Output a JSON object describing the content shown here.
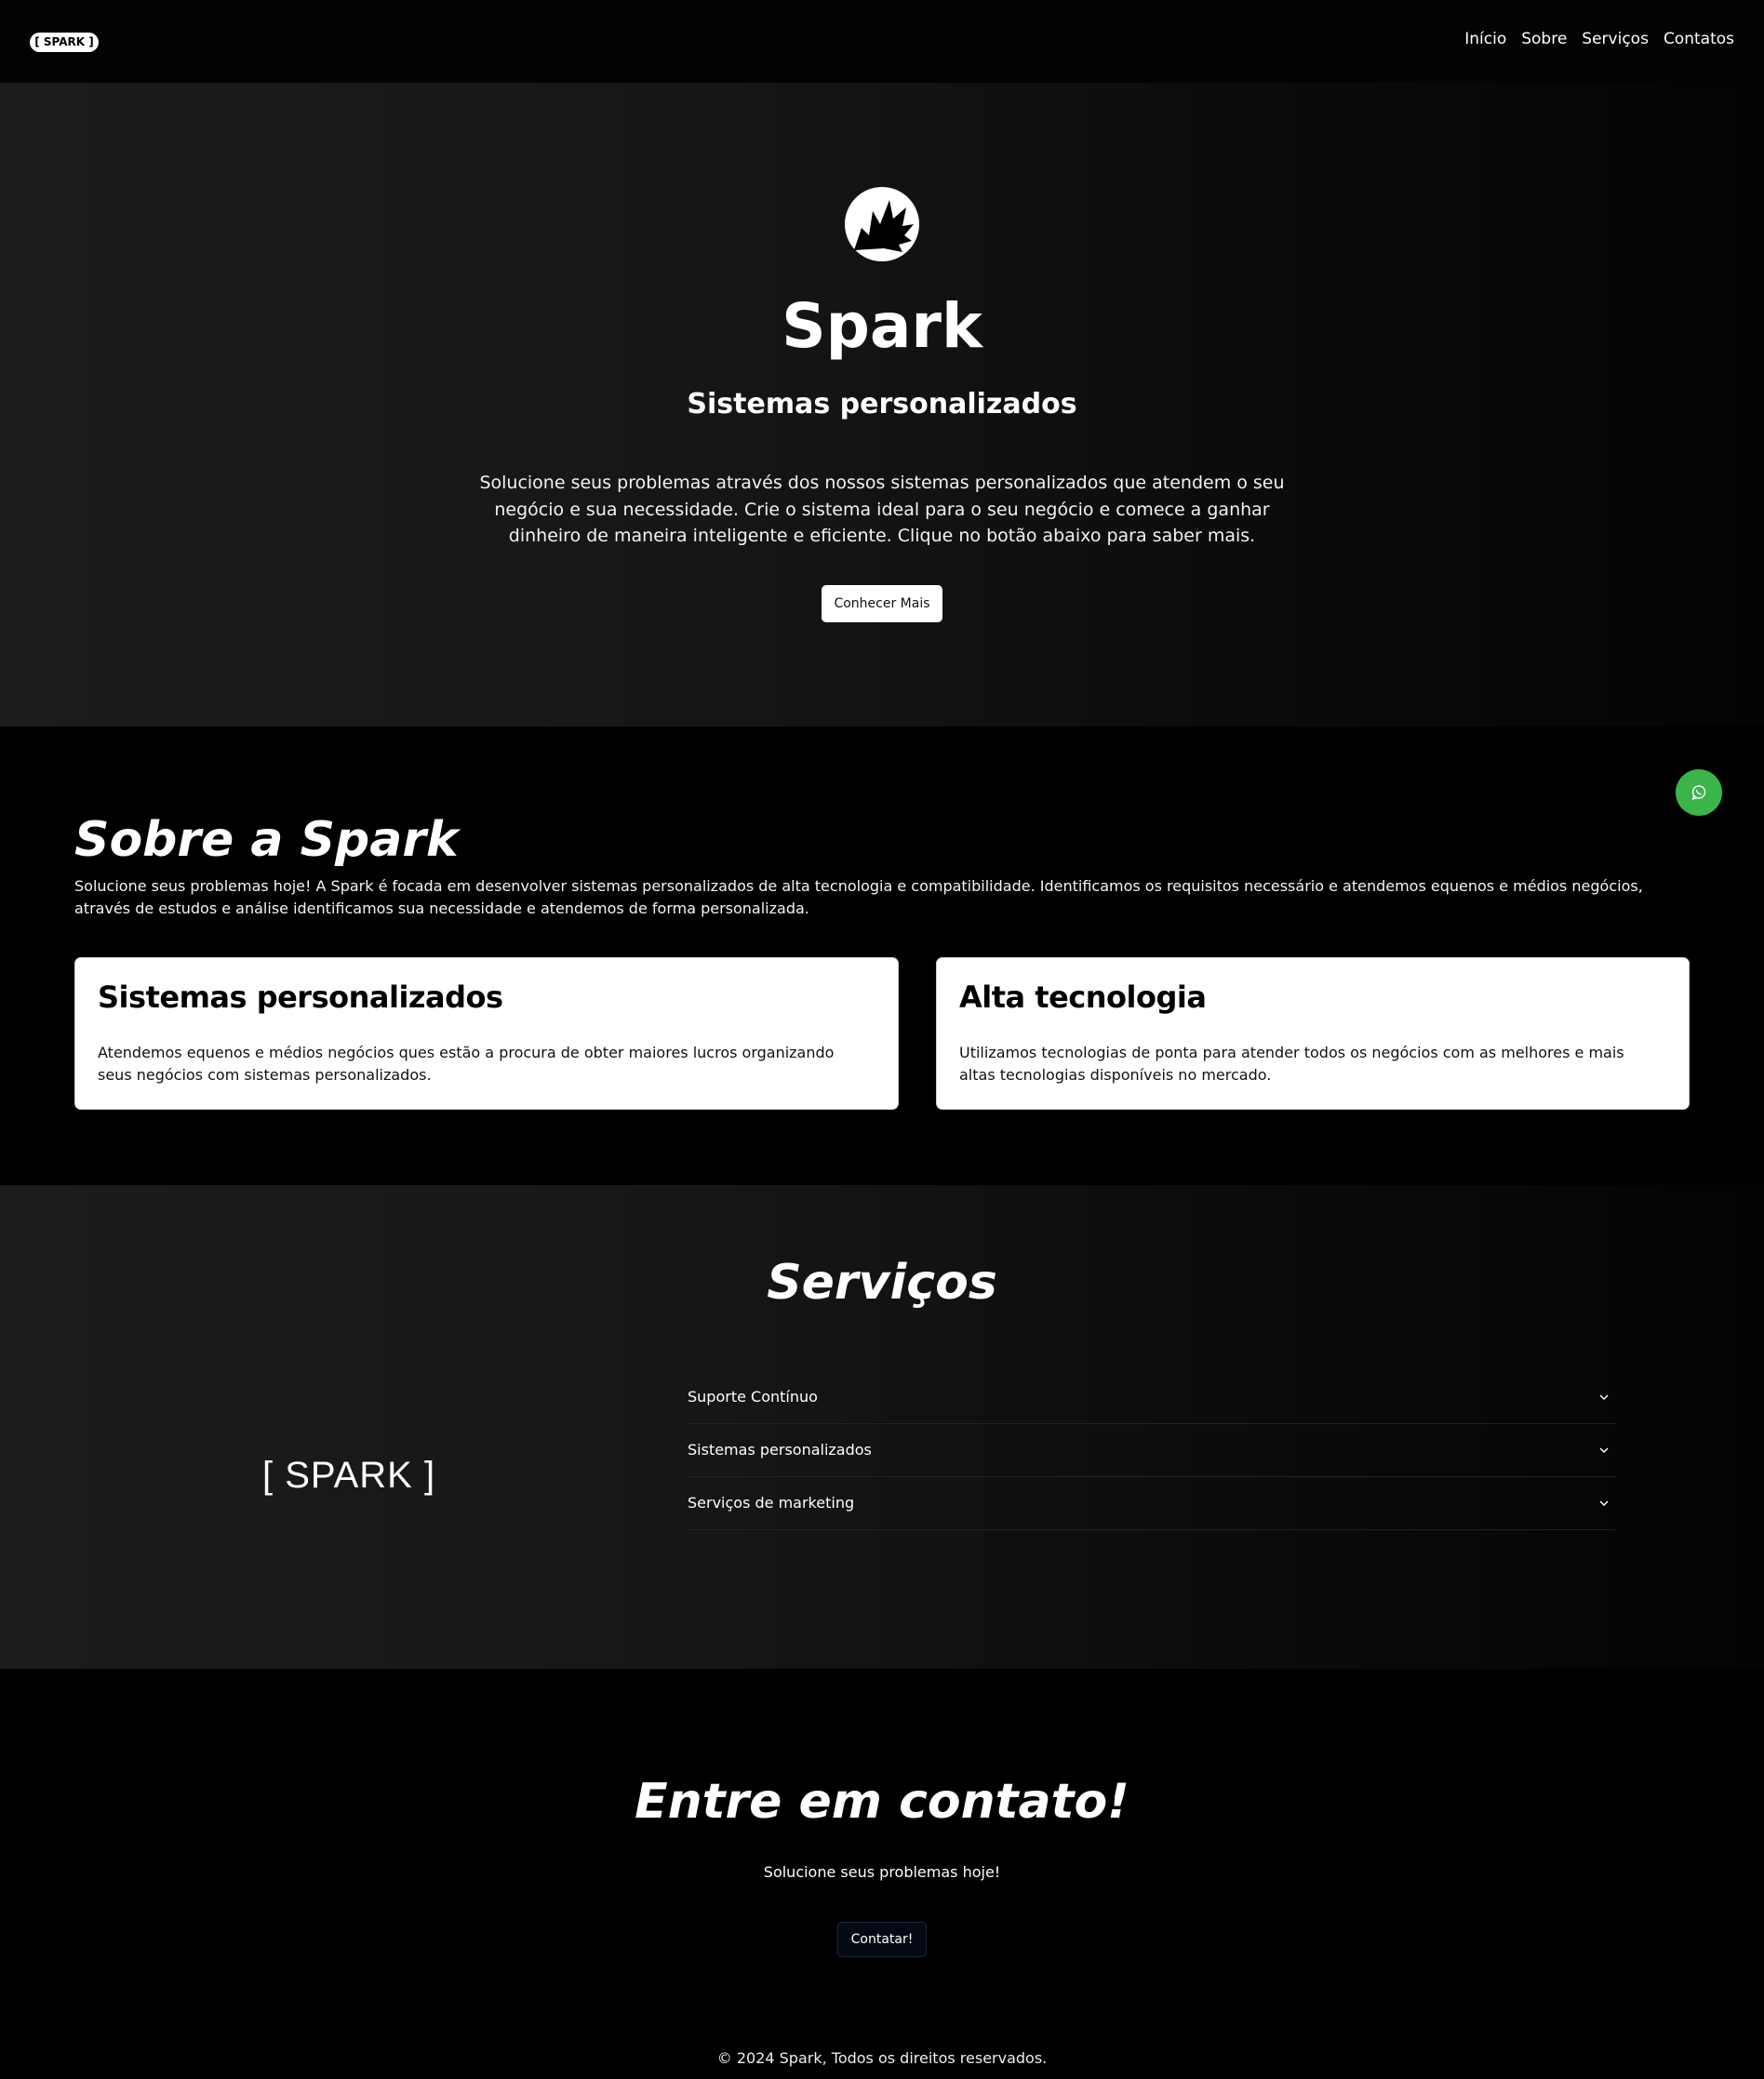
{
  "header": {
    "logo_text": "[ SPARK ]",
    "nav": [
      "Início",
      "Sobre",
      "Serviços",
      "Contatos"
    ]
  },
  "hero": {
    "logo_icon": "spark-burst-icon",
    "title": "Spark",
    "subtitle": "Sistemas personalizados",
    "description": "Solucione seus problemas através dos nossos sistemas personalizados que atendem o seu negócio e sua necessidade. Crie o sistema ideal para o seu negócio e comece a ganhar dinheiro de maneira inteligente e eficiente. Clique no botão abaixo para saber mais.",
    "button": "Conhecer Mais"
  },
  "whatsapp": {
    "icon": "whatsapp-icon",
    "color": "#3bb54a"
  },
  "sobre": {
    "title": "Sobre a Spark",
    "description": "Solucione seus problemas hoje! A Spark é focada em desenvolver sistemas personalizados de alta tecnologia e compatibilidade. Identificamos os requisitos necessário e atendemos equenos e médios negócios, através de estudos e análise identificamos sua necessidade e atendemos de forma personalizada.",
    "cards": [
      {
        "title": "Sistemas personalizados",
        "text": "Atendemos equenos e médios negócios ques estão a procura de obter maiores lucros organizando seus negócios com sistemas personalizados."
      },
      {
        "title": "Alta tecnologia",
        "text": "Utilizamos tecnologias de ponta para atender todos os negócios com as melhores e mais altas tecnologias disponíveis no mercado."
      }
    ]
  },
  "servicos": {
    "title": "Serviços",
    "brand_text": "[ SPARK ]",
    "items": [
      "Suporte Contínuo",
      "Sistemas personalizados",
      "Serviços de marketing"
    ]
  },
  "contato": {
    "title": "Entre em contato!",
    "description": "Solucione seus problemas hoje!",
    "button": "Contatar!"
  },
  "footer": {
    "text": "© 2024 Spark, Todos os direitos reservados."
  }
}
